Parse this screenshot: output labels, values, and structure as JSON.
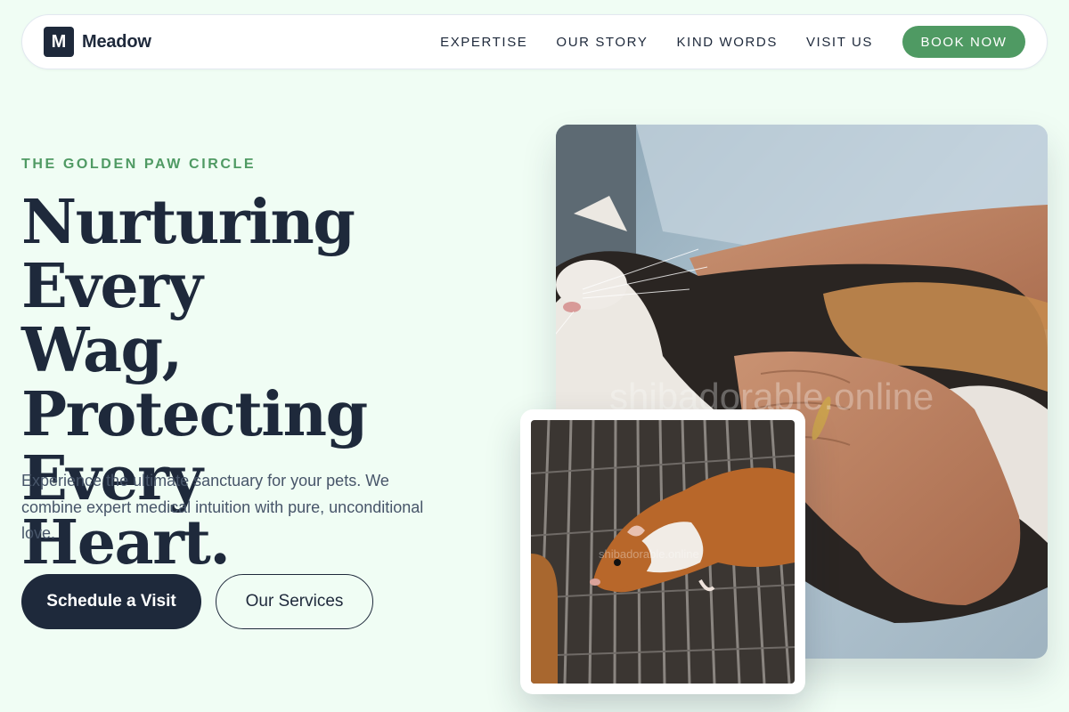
{
  "brand": {
    "logo_letter": "M",
    "name": "Meadow"
  },
  "nav": {
    "links": [
      "EXPERTISE",
      "OUR STORY",
      "KIND WORDS",
      "VISIT US"
    ],
    "cta": "BOOK NOW"
  },
  "hero": {
    "eyebrow": "THE GOLDEN PAW CIRCLE",
    "headline": [
      "Nurturing Every",
      "Wag,",
      "Protecting Every",
      "Heart."
    ],
    "subtext": "Experience the ultimate sanctuary for your pets. We combine expert medical intuition with pure, unconditional love.",
    "primary_button": "Schedule a Visit",
    "secondary_button": "Our Services"
  },
  "images": {
    "main": {
      "subject": "calico-cat-being-petted-photo",
      "watermark": "shibadorable.online"
    },
    "inset": {
      "subject": "guinea-pig-on-cage-photo",
      "watermark": "shibadorable.online"
    }
  },
  "colors": {
    "background": "#f0fdf4",
    "primary": "#1e293b",
    "accent": "#4f9a63",
    "body_text": "#475569"
  }
}
